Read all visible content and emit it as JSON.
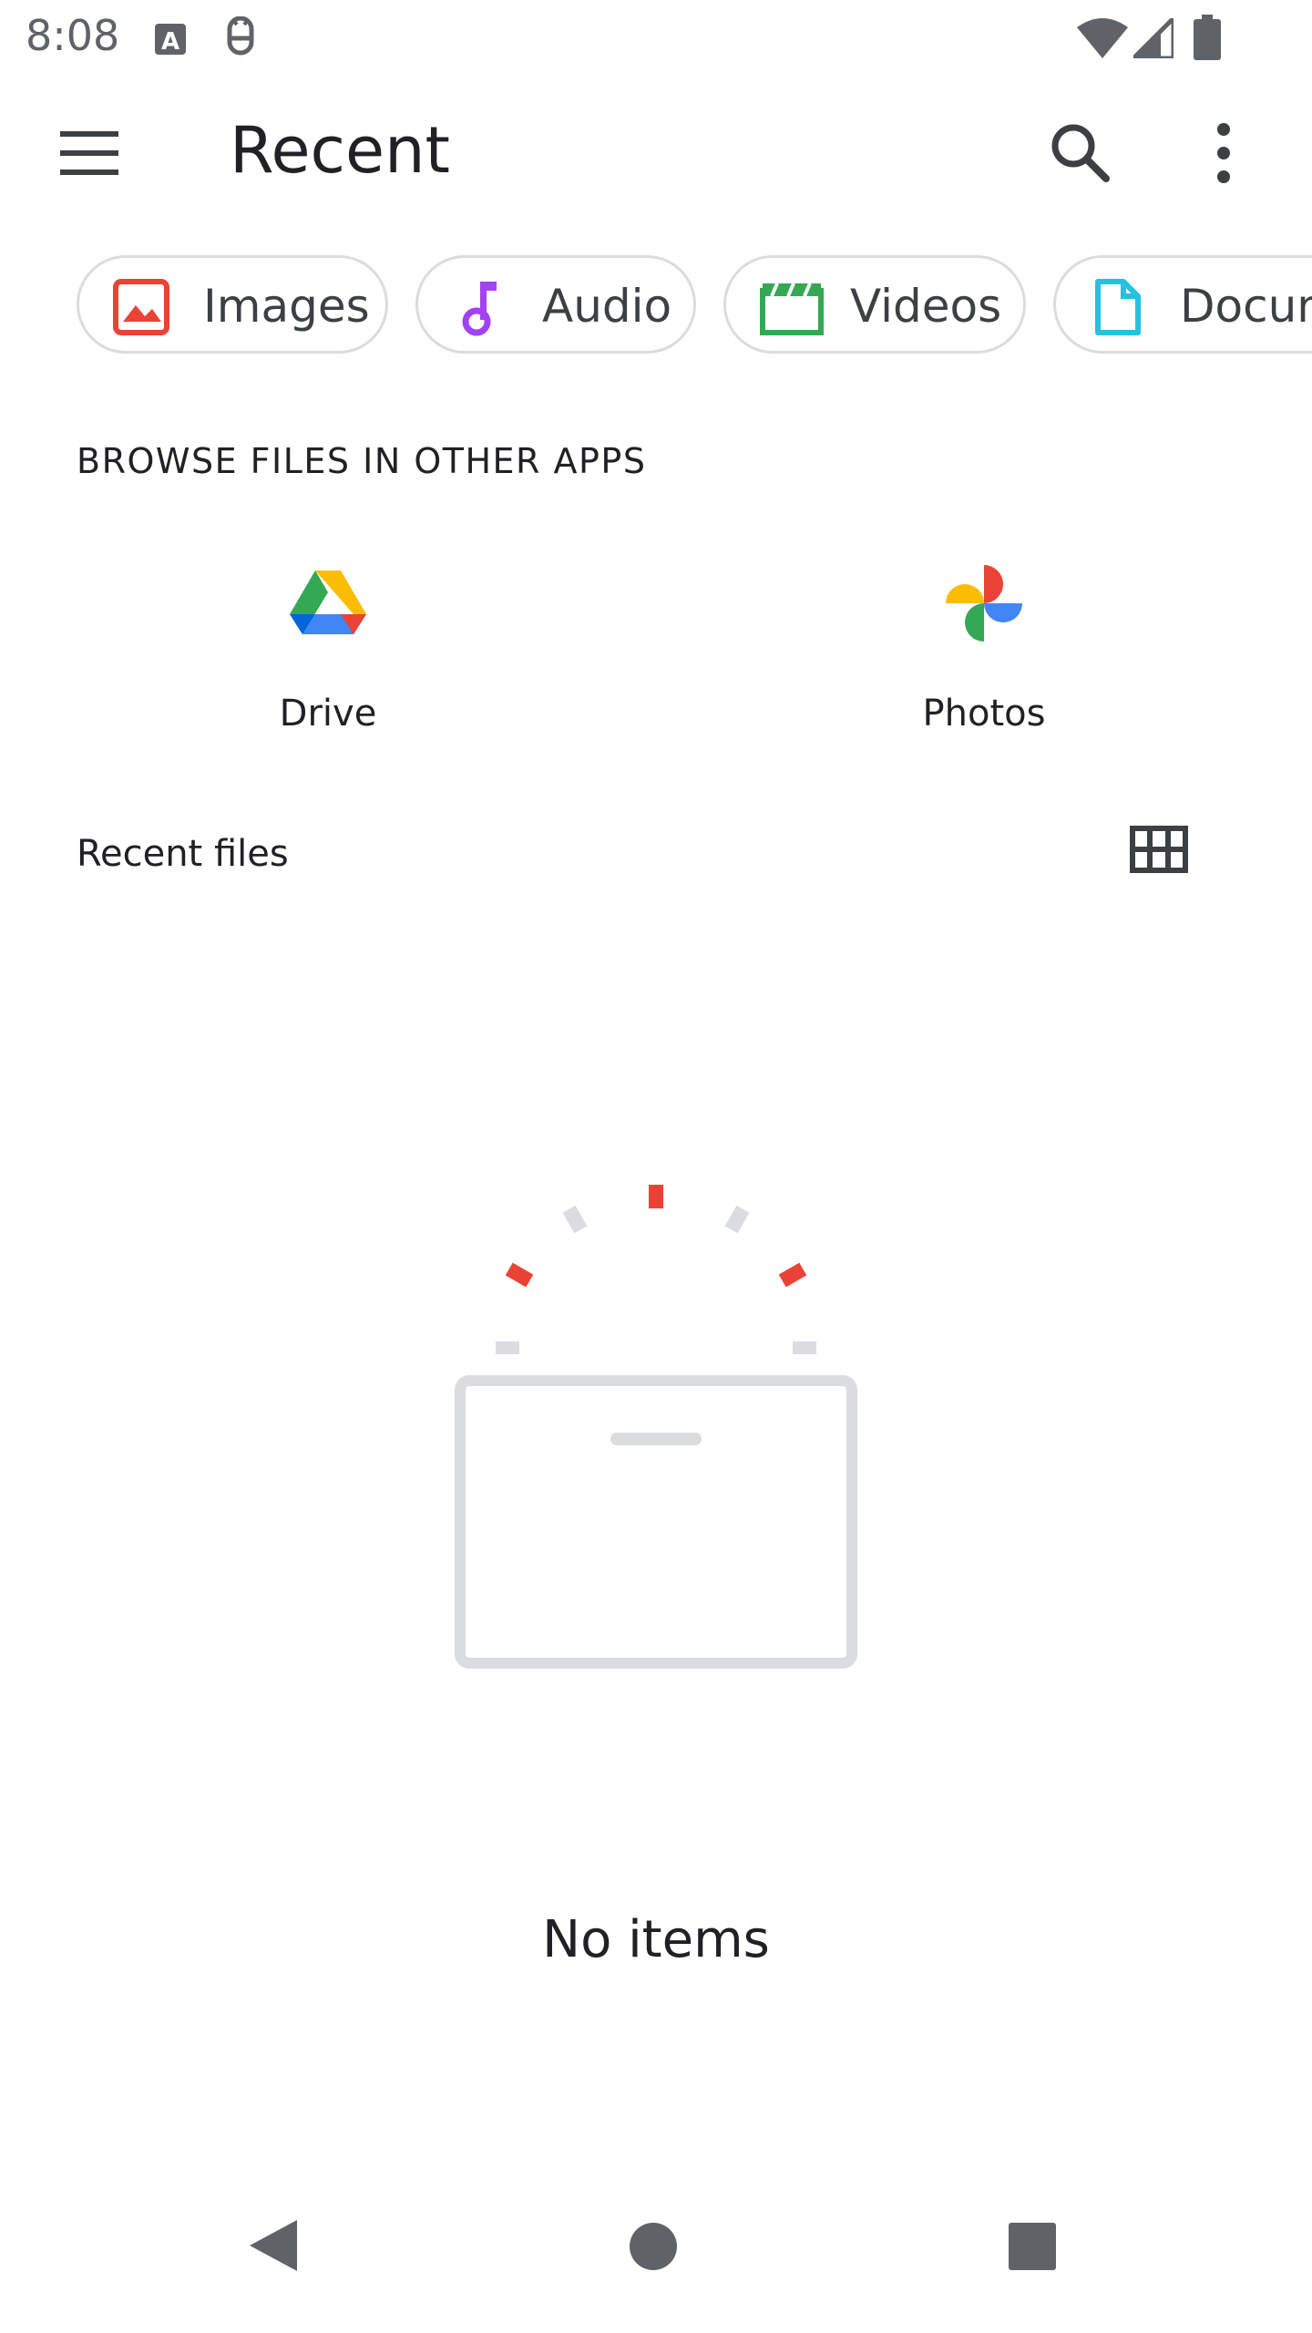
{
  "status_bar": {
    "time": "8:08",
    "notification_icons": [
      "keyboard-a-icon",
      "debug-icon"
    ],
    "system_icons": [
      "wifi-icon",
      "cell-signal-icon",
      "battery-icon"
    ]
  },
  "app_bar": {
    "title": "Recent",
    "menu_icon": "hamburger-menu-icon",
    "search_icon": "search-icon",
    "more_icon": "more-vert-icon"
  },
  "chips": [
    {
      "label": "Images",
      "icon": "image-icon",
      "color": "#ea4335"
    },
    {
      "label": "Audio",
      "icon": "music-note-icon",
      "color": "#a142f4"
    },
    {
      "label": "Videos",
      "icon": "movie-icon",
      "color": "#34a853"
    },
    {
      "label": "Docum",
      "icon": "document-icon",
      "color": "#24c1e0"
    }
  ],
  "browse_section": {
    "heading": "BROWSE FILES IN OTHER APPS",
    "apps": [
      {
        "label": "Drive",
        "icon": "google-drive-icon"
      },
      {
        "label": "Photos",
        "icon": "google-photos-icon"
      }
    ]
  },
  "recent_files": {
    "heading": "Recent files",
    "view_toggle_icon": "grid-view-icon",
    "empty_state": {
      "illustration": "empty-box-illustration",
      "message": "No items"
    }
  },
  "nav_bar": {
    "icons": [
      "back-icon",
      "home-icon",
      "recents-icon"
    ]
  },
  "colors": {
    "accent_red": "#ea4335",
    "text_primary": "#202124",
    "outline": "#dadce0",
    "illustration_gray": "#dadce0"
  }
}
